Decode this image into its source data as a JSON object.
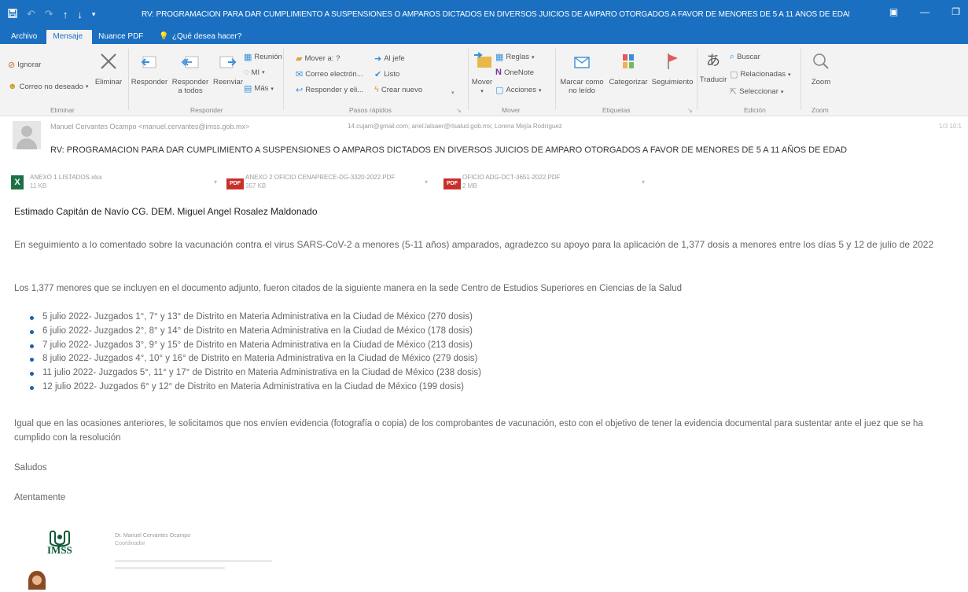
{
  "window": {
    "title": "RV: PROGRAMACIÓN PARA DAR CUMPLIMIENTO A SUSPENSIONES O AMPAROS DICTADOS EN DIVERSOS JUICIOS DE AMPARO OTORGADOS A FAVOR DE MENORES DE 5 A 11 AÑOS DE EDAD - Mensaje (HTML)"
  },
  "tabs": {
    "archivo": "Archivo",
    "mensaje": "Mensaje",
    "nuance": "Nuance PDF",
    "search": "¿Qué desea hacer?"
  },
  "ribbon": {
    "eliminar": {
      "ignorar": "Ignorar",
      "correo_no_deseado": "Correo no deseado",
      "eliminar": "Eliminar",
      "label": "Eliminar"
    },
    "responder": {
      "responder": "Responder",
      "responder_todos_1": "Responder",
      "responder_todos_2": "a todos",
      "reenviar": "Reenviar",
      "reunion": "Reunión",
      "mi": "MI",
      "mas": "Más",
      "label": "Responder"
    },
    "pasos": {
      "mover_a": "Mover a: ?",
      "correo_electronico": "Correo electrón...",
      "responder_y_eliminar": "Responder y eli...",
      "al_jefe": "Al jefe",
      "listo": "Listo",
      "crear_nuevo": "Crear nuevo",
      "label": "Pasos rápidos"
    },
    "mover": {
      "mover": "Mover",
      "reglas": "Reglas",
      "onenote": "OneNote",
      "acciones": "Acciones",
      "label": "Mover"
    },
    "etiquetas": {
      "marcar_1": "Marcar como",
      "marcar_2": "no leído",
      "categorizar": "Categorizar",
      "seguimiento": "Seguimiento",
      "label": "Etiquetas"
    },
    "edicion": {
      "traducir": "Traducir",
      "buscar": "Buscar",
      "relacionadas": "Relacionadas",
      "seleccionar": "Seleccionar",
      "label": "Edición"
    },
    "zoom": {
      "zoom": "Zoom",
      "label": "Zoom"
    }
  },
  "header": {
    "from": "Manuel Cervantes Ocampo <manuel.cervantes@imss.gob.mx>",
    "to": "14.cujam@gmail.com;   ariel.lalsaer@rlsalud.gob.mx;   Lorena Mejía Rodríguez",
    "meta": "1/3    10:1",
    "subject": "RV: PROGRAMACION PARA DAR CUMPLIMIENTO A SUSPENSIONES O AMPAROS DICTADOS EN DIVERSOS JUICIOS DE AMPARO OTORGADOS A FAVOR DE MENORES DE 5 A 11 AÑOS DE EDAD"
  },
  "attachments": [
    {
      "name": "ANEXO 1 LISTADOS.xlsx",
      "size": "11 KB",
      "type": "xlsx"
    },
    {
      "name": "ANEXO 2 OFICIO CENAPRECE-DG-3320-2022.PDF",
      "size": "357 KB",
      "type": "pdf"
    },
    {
      "name": "OFICIO ADG-DCT-3651-2022.PDF",
      "size": "2 MB",
      "type": "pdf"
    }
  ],
  "body": {
    "greeting": "Estimado Capitán de Navío CG. DEM. Miguel Angel Rosalez Maldonado",
    "p1": "En seguimiento a lo comentado sobre la vacunación contra el virus SARS-CoV-2 a menores (5-11 años) amparados, agradezco su apoyo para la aplicación de 1,377 dosis a menores entre los días 5 y 12 de julio de 2022",
    "p2": "Los 1,377 menores que se incluyen en el documento adjunto, fueron citados de la siguiente manera en la sede Centro de Estudios Superiores en Ciencias de la Salud",
    "schedule": [
      "5 julio 2022- Juzgados 1°, 7° y 13° de Distrito en Materia Administrativa en la Ciudad de México (270 dosis)",
      "6 julio 2022- Juzgados 2°, 8° y 14° de Distrito en Materia Administrativa en la Ciudad de México (178 dosis)",
      "7 julio 2022- Juzgados 3°, 9° y 15° de Distrito en Materia Administrativa en la Ciudad de México (213 dosis)",
      "8 julio 2022- Juzgados 4°, 10° y 16° de Distrito en Materia Administrativa en la Ciudad de México (279 dosis)",
      "11 julio 2022- Juzgados 5°, 11° y 17° de Distrito en Materia Administrativa en la Ciudad de México (238 dosis)",
      "12 julio 2022- Juzgados 6° y 12° de Distrito en Materia Administrativa en la Ciudad de México (199 dosis)"
    ],
    "p3": "Igual que en las ocasiones anteriores, le solicitamos que nos envíen evidencia (fotografía o copia) de los comprobantes de vacunación, esto con el objetivo de tener la evidencia documental para sustentar ante el juez que se ha cumplido con la resolución",
    "saludos": "Saludos",
    "atentamente": "Atentamente"
  },
  "signature": {
    "logo": "IMSS",
    "name": "Dr. Manuel Cervantes Ocampo",
    "role": "Coordinador"
  },
  "colors": {
    "accent": "#1a6fc0",
    "excel": "#1d7044",
    "pdf": "#c9302c",
    "bullet": "#1a5fb4"
  }
}
